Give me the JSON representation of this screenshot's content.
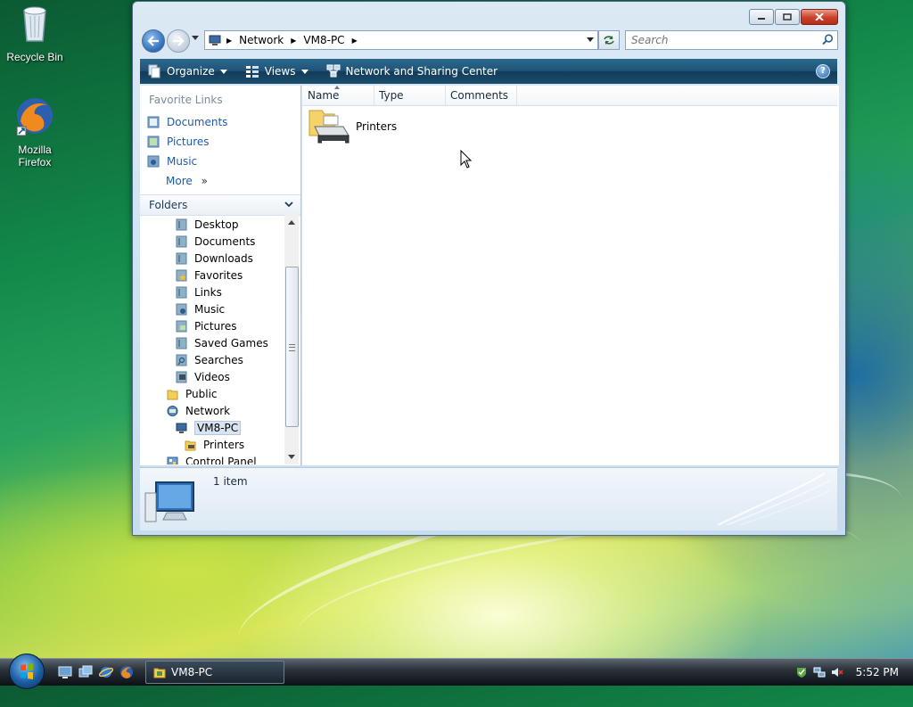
{
  "desktop": {
    "icons": [
      {
        "label": "Recycle Bin"
      },
      {
        "label": "Mozilla Firefox"
      }
    ]
  },
  "window": {
    "address": {
      "crumbs": [
        "Network",
        "VM8-PC"
      ]
    },
    "search": {
      "placeholder": "Search"
    },
    "toolbar": {
      "organize": "Organize",
      "views": "Views",
      "network_sharing": "Network and Sharing Center",
      "help": "?"
    },
    "nav_pane": {
      "favorite_links_title": "Favorite Links",
      "favorite_links": [
        "Documents",
        "Pictures",
        "Music"
      ],
      "more": "More",
      "folders_title": "Folders",
      "tree": [
        {
          "label": "Desktop",
          "icon": "desktop-folder-icon"
        },
        {
          "label": "Documents",
          "icon": "documents-folder-icon"
        },
        {
          "label": "Downloads",
          "icon": "downloads-folder-icon"
        },
        {
          "label": "Favorites",
          "icon": "favorites-folder-icon"
        },
        {
          "label": "Links",
          "icon": "links-folder-icon"
        },
        {
          "label": "Music",
          "icon": "music-folder-icon"
        },
        {
          "label": "Pictures",
          "icon": "pictures-folder-icon"
        },
        {
          "label": "Saved Games",
          "icon": "saved-games-folder-icon"
        },
        {
          "label": "Searches",
          "icon": "searches-folder-icon"
        },
        {
          "label": "Videos",
          "icon": "videos-folder-icon"
        },
        {
          "label": "Public",
          "icon": "public-folder-icon"
        },
        {
          "label": "Network",
          "icon": "network-icon"
        },
        {
          "label": "VM8-PC",
          "icon": "computer-icon"
        },
        {
          "label": "Printers",
          "icon": "printers-folder-icon"
        },
        {
          "label": "Control Panel",
          "icon": "control-panel-icon"
        }
      ]
    },
    "columns": [
      "Name",
      "Type",
      "Comments"
    ],
    "items": [
      {
        "label": "Printers"
      }
    ],
    "details": {
      "count": "1 item"
    }
  },
  "taskbar": {
    "task_button": "VM8-PC",
    "clock": "5:52 PM"
  },
  "colors": {
    "link": "#1f5aa6",
    "toolbar": "#1f5376",
    "close_button": "#c8412b"
  }
}
